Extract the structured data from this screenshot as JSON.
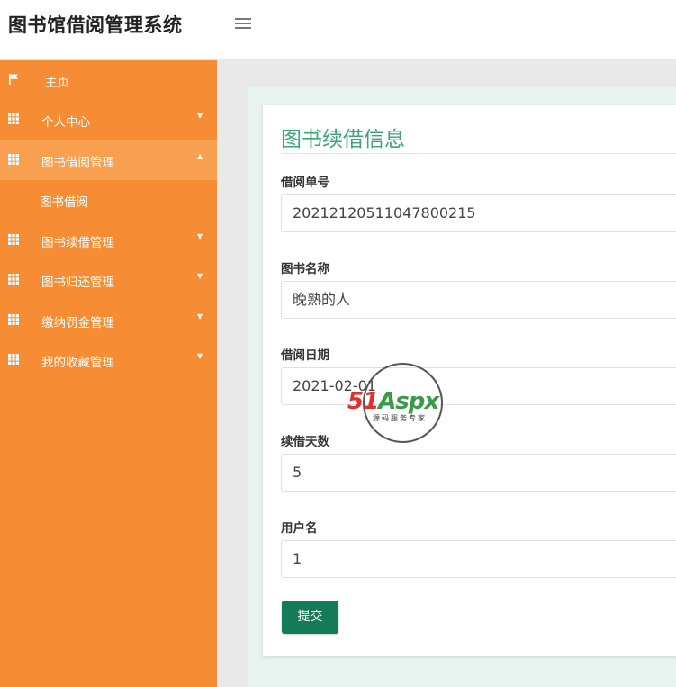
{
  "header": {
    "title": "图书馆借阅管理系统",
    "menu_toggle_icon": "hamburger-icon"
  },
  "sidebar": {
    "items": [
      {
        "label": "主页",
        "icon": "flag-icon"
      },
      {
        "label": "个人中心",
        "icon": "grid-icon"
      },
      {
        "label": "图书借阅管理",
        "icon": "grid-icon",
        "expanded": true
      },
      {
        "label": "图书续借管理",
        "icon": "grid-icon"
      },
      {
        "label": "图书归还管理",
        "icon": "grid-icon"
      },
      {
        "label": "缴纳罚金管理",
        "icon": "grid-icon"
      },
      {
        "label": "我的收藏管理",
        "icon": "grid-icon"
      }
    ],
    "subitems": [
      {
        "label": "图书借阅"
      }
    ],
    "accent_color": "#f68d35",
    "active_color": "#f8a04f"
  },
  "form": {
    "title": "图书续借信息",
    "fields": [
      {
        "label": "借阅单号",
        "value": "20212120511047800215"
      },
      {
        "label": "图书名称",
        "value": "晚熟的人"
      },
      {
        "label": "借阅日期",
        "value": "2021-02-01"
      },
      {
        "label": "续借天数",
        "value": "5"
      },
      {
        "label": "用户名",
        "value": "1"
      }
    ],
    "submit_label": "提交",
    "title_color": "#3aa575",
    "button_color": "#157a57"
  },
  "watermark": {
    "brand_red": "51",
    "brand_green": "Aspx",
    "tagline": "源码服务专家"
  }
}
